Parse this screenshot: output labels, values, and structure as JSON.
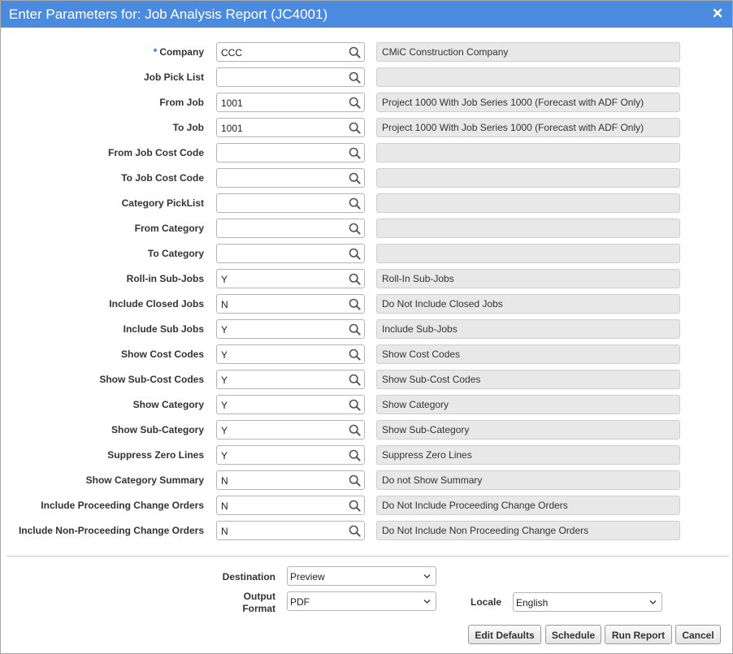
{
  "dialog": {
    "title": "Enter Parameters for: Job Analysis Report (JC4001)"
  },
  "params": [
    {
      "label": "Company",
      "required": "*",
      "value": "CCC",
      "desc": "CMiC Construction Company"
    },
    {
      "label": "Job Pick List",
      "value": "",
      "desc": ""
    },
    {
      "label": "From Job",
      "value": "1001",
      "desc": "Project 1000 With Job Series 1000 (Forecast with ADF Only)"
    },
    {
      "label": "To Job",
      "value": "1001",
      "desc": "Project 1000 With Job Series 1000 (Forecast with ADF Only)"
    },
    {
      "label": "From Job Cost Code",
      "value": "",
      "desc": ""
    },
    {
      "label": "To Job Cost Code",
      "value": "",
      "desc": ""
    },
    {
      "label": "Category PickList",
      "value": "",
      "desc": ""
    },
    {
      "label": "From Category",
      "value": "",
      "desc": ""
    },
    {
      "label": "To Category",
      "value": "",
      "desc": ""
    },
    {
      "label": "Roll-in Sub-Jobs",
      "value": "Y",
      "desc": "Roll-In Sub-Jobs"
    },
    {
      "label": "Include Closed Jobs",
      "value": "N",
      "desc": "Do Not Include Closed Jobs"
    },
    {
      "label": "Include Sub Jobs",
      "value": "Y",
      "desc": "Include Sub-Jobs"
    },
    {
      "label": "Show Cost Codes",
      "value": "Y",
      "desc": "Show Cost Codes"
    },
    {
      "label": "Show Sub-Cost Codes",
      "value": "Y",
      "desc": "Show Sub-Cost Codes"
    },
    {
      "label": "Show Category",
      "value": "Y",
      "desc": "Show Category"
    },
    {
      "label": "Show Sub-Category",
      "value": "Y",
      "desc": "Show Sub-Category"
    },
    {
      "label": "Suppress Zero Lines",
      "value": "Y",
      "desc": "Suppress Zero Lines"
    },
    {
      "label": "Show Category Summary",
      "value": "N",
      "desc": "Do not Show Summary"
    },
    {
      "label": "Include Proceeding Change Orders",
      "value": "N",
      "desc": "Do Not Include Proceeding Change Orders"
    },
    {
      "label": "Include Non-Proceeding Change Orders",
      "value": "N",
      "desc": "Do Not Include Non Proceeding Change Orders"
    }
  ],
  "footer": {
    "destination_label": "Destination",
    "destination_value": "Preview",
    "output_format_label_1": "Output",
    "output_format_label_2": "Format",
    "output_format_value": "PDF",
    "locale_label": "Locale",
    "locale_value": "English"
  },
  "buttons": {
    "edit_defaults": "Edit Defaults",
    "schedule": "Schedule",
    "run_report": "Run Report",
    "cancel": "Cancel"
  },
  "icons": {
    "lookup": "magnifier-icon",
    "close": "close-icon",
    "dropdown": "chevron-down-icon"
  },
  "colors": {
    "titlebar": "#4a8be0",
    "required_marker": "#2b6cc4",
    "desc_bg": "#e8e8e8"
  }
}
